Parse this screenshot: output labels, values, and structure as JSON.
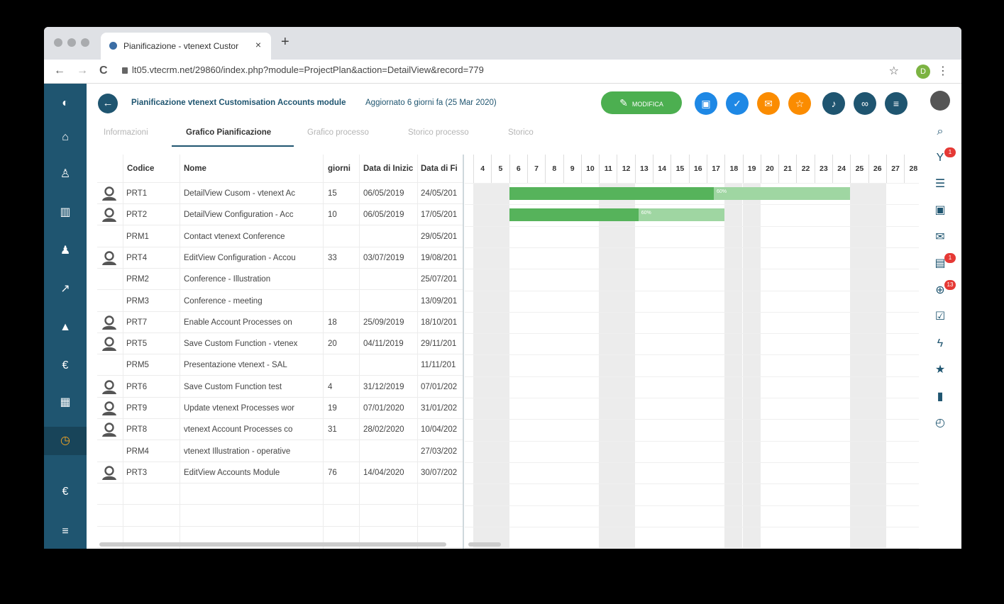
{
  "browser": {
    "tab_title": "Pianificazione - vtenext Custor",
    "tab_close": "×",
    "new_tab": "+",
    "url": "lt05.vtecrm.net/29860/index.php?module=ProjectPlan&action=DetailView&record=779",
    "profile_initial": "D",
    "back": "←",
    "forward": "→",
    "reload": "C",
    "star": "☆",
    "menu": "⋮"
  },
  "header": {
    "title": "Pianificazione vtenext Customisation Accounts module",
    "subtitle": "Aggiornato 6 giorni fa (25 Mar 2020)",
    "edit_label": "MODIFICA",
    "edit_icon": "✎",
    "back_icon": "←",
    "buttons": [
      {
        "icon": "calendar-icon",
        "glyph": "▣",
        "color": "#1e88e5"
      },
      {
        "icon": "task-icon",
        "glyph": "✓",
        "color": "#1e88e5"
      },
      {
        "icon": "mail-icon",
        "glyph": "✉",
        "color": "#fb8c00"
      },
      {
        "icon": "star-icon",
        "glyph": "☆",
        "color": "#fb8c00"
      },
      {
        "icon": "bell-icon",
        "glyph": "♪",
        "color": "#1f5570"
      },
      {
        "icon": "link-icon",
        "glyph": "∞",
        "color": "#1f5570"
      },
      {
        "icon": "list-icon",
        "glyph": "≡",
        "color": "#1f5570"
      }
    ]
  },
  "tabs": [
    "Informazioni",
    "Grafico Pianificazione",
    "Grafico processo",
    "Storico processo",
    "Storico"
  ],
  "grid": {
    "columns": [
      "Codice",
      "Nome",
      "giorni",
      "Data di Inizic",
      "Data di Fi"
    ],
    "rows": [
      {
        "res": true,
        "code": "PRT1",
        "name": "DetailView Cusom - vtenext Ac",
        "days": "15",
        "start": "06/05/2019",
        "end": "24/05/201"
      },
      {
        "res": true,
        "code": "PRT2",
        "name": "DetailView Configuration - Acc",
        "days": "10",
        "start": "06/05/2019",
        "end": "17/05/201"
      },
      {
        "res": false,
        "code": "PRM1",
        "name": "Contact vtenext Conference",
        "days": "",
        "start": "",
        "end": "29/05/201"
      },
      {
        "res": true,
        "code": "PRT4",
        "name": "EditView Configuration - Accou",
        "days": "33",
        "start": "03/07/2019",
        "end": "19/08/201"
      },
      {
        "res": false,
        "code": "PRM2",
        "name": "Conference - Illustration",
        "days": "",
        "start": "",
        "end": "25/07/201"
      },
      {
        "res": false,
        "code": "PRM3",
        "name": "Conference - meeting",
        "days": "",
        "start": "",
        "end": "13/09/201"
      },
      {
        "res": true,
        "code": "PRT7",
        "name": "Enable Account Processes on",
        "days": "18",
        "start": "25/09/2019",
        "end": "18/10/201"
      },
      {
        "res": true,
        "code": "PRT5",
        "name": "Save Custom Function - vtenex",
        "days": "20",
        "start": "04/11/2019",
        "end": "29/11/201"
      },
      {
        "res": false,
        "code": "PRM5",
        "name": "Presentazione vtenext - SAL",
        "days": "",
        "start": "",
        "end": "11/11/201"
      },
      {
        "res": true,
        "code": "PRT6",
        "name": "Save Custom Function test",
        "days": "4",
        "start": "31/12/2019",
        "end": "07/01/202"
      },
      {
        "res": true,
        "code": "PRT9",
        "name": "Update vtenext Processes wor",
        "days": "19",
        "start": "07/01/2020",
        "end": "31/01/202"
      },
      {
        "res": true,
        "code": "PRT8",
        "name": "vtenext Account Processes co",
        "days": "31",
        "start": "28/02/2020",
        "end": "10/04/202"
      },
      {
        "res": false,
        "code": "PRM4",
        "name": "vtenext Illustration - operative",
        "days": "",
        "start": "",
        "end": "27/03/202"
      },
      {
        "res": true,
        "code": "PRT3",
        "name": "EditView Accounts Module",
        "days": "76",
        "start": "14/04/2020",
        "end": "30/07/202"
      }
    ]
  },
  "gantt": {
    "days": [
      "4",
      "5",
      "6",
      "7",
      "8",
      "9",
      "10",
      "11",
      "12",
      "13",
      "14",
      "15",
      "16",
      "17",
      "18",
      "19",
      "20",
      "21",
      "22",
      "23",
      "24",
      "25",
      "26",
      "27",
      "28"
    ],
    "weekend_days": [
      "4",
      "5",
      "11",
      "12",
      "18",
      "19",
      "25",
      "26"
    ],
    "bars": [
      {
        "row": 0,
        "start_day": "6",
        "end_day": "24",
        "progress": 0.6,
        "label": "60%"
      },
      {
        "row": 1,
        "start_day": "6",
        "end_day": "17",
        "progress": 0.6,
        "label": "60%"
      }
    ]
  },
  "left_nav": [
    {
      "icon": "logo-icon",
      "glyph": "◐"
    },
    {
      "icon": "home-icon",
      "glyph": "⌂"
    },
    {
      "icon": "contacts-icon",
      "glyph": "♙"
    },
    {
      "icon": "accounts-icon",
      "glyph": "▥"
    },
    {
      "icon": "user-icon",
      "glyph": "♟"
    },
    {
      "icon": "chart-icon",
      "glyph": "↗"
    },
    {
      "icon": "alert-icon",
      "glyph": "▲"
    },
    {
      "icon": "euro-icon",
      "glyph": "€"
    },
    {
      "icon": "table-icon",
      "glyph": "▦"
    },
    {
      "icon": "clock-icon",
      "glyph": "◷"
    },
    {
      "icon": "euro-bottom-icon",
      "glyph": "€"
    },
    {
      "icon": "menu-icon",
      "glyph": "≡"
    }
  ],
  "right_nav": [
    {
      "icon": "search-icon",
      "glyph": "⌕",
      "badge": ""
    },
    {
      "icon": "filter-icon",
      "glyph": "Y",
      "badge": "1"
    },
    {
      "icon": "list-icon",
      "glyph": "☰",
      "badge": ""
    },
    {
      "icon": "calendar-icon",
      "glyph": "▣",
      "badge": ""
    },
    {
      "icon": "mail-icon",
      "glyph": "✉",
      "badge": ""
    },
    {
      "icon": "chat-icon",
      "glyph": "▤",
      "badge": "1"
    },
    {
      "icon": "globe-icon",
      "glyph": "⊕",
      "badge": "13"
    },
    {
      "icon": "task-icon",
      "glyph": "☑",
      "badge": ""
    },
    {
      "icon": "bolt-icon",
      "glyph": "ϟ",
      "badge": ""
    },
    {
      "icon": "star-icon",
      "glyph": "★",
      "badge": ""
    },
    {
      "icon": "document-icon",
      "glyph": "▮",
      "badge": ""
    },
    {
      "icon": "timer-icon",
      "glyph": "◴",
      "badge": ""
    }
  ]
}
